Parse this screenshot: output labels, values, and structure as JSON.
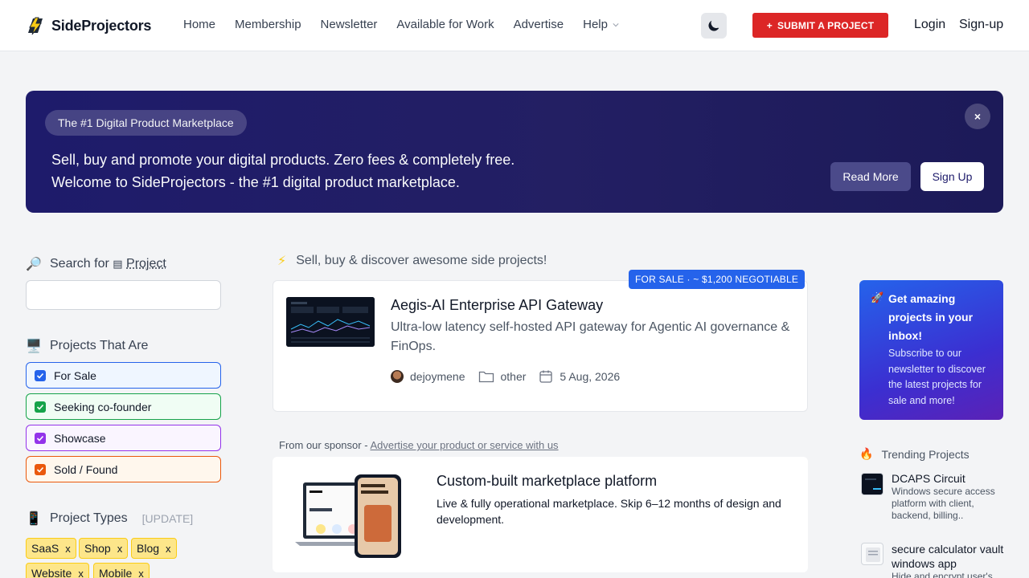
{
  "header": {
    "brand": "SideProjectors",
    "nav": [
      "Home",
      "Membership",
      "Newsletter",
      "Available for Work",
      "Advertise",
      "Help"
    ],
    "submit_label": "SUBMIT A PROJECT",
    "login": "Login",
    "signup": "Sign-up"
  },
  "banner": {
    "pill": "The #1 Digital Product Marketplace",
    "line1": "Sell, buy and promote your digital products. Zero fees & completely free.",
    "line2": "Welcome to SideProjectors - the #1 digital product marketplace.",
    "close": "×",
    "read_more": "Read More",
    "sign_up": "Sign Up"
  },
  "sidebar": {
    "search_label": "Search for",
    "search_target": "Project",
    "search_placeholder": "",
    "projects_that_are": "Projects That Are",
    "filters": [
      {
        "label": "For Sale",
        "color": "#2563eb",
        "bg": "#eff6ff"
      },
      {
        "label": "Seeking co-founder",
        "color": "#16a34a",
        "bg": "#f0fdf4"
      },
      {
        "label": "Showcase",
        "color": "#9333ea",
        "bg": "#faf5ff"
      },
      {
        "label": "Sold / Found",
        "color": "#ea580c",
        "bg": "#fff7ed"
      }
    ],
    "project_types": "Project Types",
    "types_note": "[UPDATE]",
    "tags": [
      "SaaS",
      "Shop",
      "Blog",
      "Website",
      "Mobile"
    ]
  },
  "main": {
    "heading": "Sell, buy & discover awesome side projects!",
    "listing": {
      "badge": "FOR SALE · ~ $1,200 NEGOTIABLE",
      "title": "Aegis-AI Enterprise API Gateway",
      "description": "Ultra-low latency self-hosted API gateway for Agentic AI governance & FinOps.",
      "author": "dejoymene",
      "category": "other",
      "date": "5 Aug, 2026"
    },
    "sponsor_prefix": "From our sponsor -",
    "sponsor_link": "Advertise your product or service with us",
    "sponsor": {
      "title": "Custom-built marketplace platform",
      "description": "Live & fully operational marketplace. Skip 6–12 months of design and development."
    }
  },
  "right": {
    "newsletter_title": "Get amazing projects in your inbox!",
    "newsletter_desc": "Subscribe to our newsletter to discover the latest projects for sale and more!",
    "trending_head": "Trending Projects",
    "trending": [
      {
        "title": "DCAPS Circuit",
        "desc": "Windows secure access platform with client, backend, billing.."
      },
      {
        "title": "secure calculator vault windows app",
        "desc": "Hide and encrypt user's"
      }
    ]
  }
}
